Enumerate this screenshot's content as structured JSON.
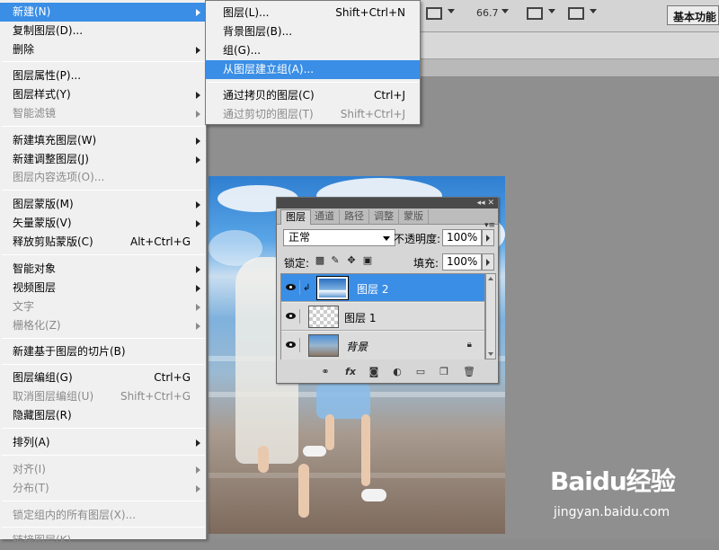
{
  "toolbar": {
    "zoom_value": "66.7",
    "workspace_label": "基本功能"
  },
  "menu": {
    "items": [
      {
        "label": "新建(N)",
        "shortcut": "",
        "submenu": true,
        "disabled": false,
        "highlighted": true
      },
      {
        "label": "复制图层(D)...",
        "shortcut": "",
        "submenu": false,
        "disabled": false
      },
      {
        "label": "删除",
        "shortcut": "",
        "submenu": true,
        "disabled": false
      },
      {
        "label": "图层属性(P)...",
        "shortcut": "",
        "submenu": false,
        "disabled": false
      },
      {
        "label": "图层样式(Y)",
        "shortcut": "",
        "submenu": true,
        "disabled": false
      },
      {
        "label": "智能滤镜",
        "shortcut": "",
        "submenu": true,
        "disabled": true
      },
      {
        "label": "新建填充图层(W)",
        "shortcut": "",
        "submenu": true,
        "disabled": false
      },
      {
        "label": "新建调整图层(J)",
        "shortcut": "",
        "submenu": true,
        "disabled": false
      },
      {
        "label": "图层内容选项(O)...",
        "shortcut": "",
        "submenu": false,
        "disabled": true
      },
      {
        "label": "图层蒙版(M)",
        "shortcut": "",
        "submenu": true,
        "disabled": false
      },
      {
        "label": "矢量蒙版(V)",
        "shortcut": "",
        "submenu": true,
        "disabled": false
      },
      {
        "label": "释放剪贴蒙版(C)",
        "shortcut": "Alt+Ctrl+G",
        "submenu": false,
        "disabled": false
      },
      {
        "label": "智能对象",
        "shortcut": "",
        "submenu": true,
        "disabled": false
      },
      {
        "label": "视频图层",
        "shortcut": "",
        "submenu": true,
        "disabled": false
      },
      {
        "label": "文字",
        "shortcut": "",
        "submenu": true,
        "disabled": true
      },
      {
        "label": "栅格化(Z)",
        "shortcut": "",
        "submenu": true,
        "disabled": true
      },
      {
        "label": "新建基于图层的切片(B)",
        "shortcut": "",
        "submenu": false,
        "disabled": false
      },
      {
        "label": "图层编组(G)",
        "shortcut": "Ctrl+G",
        "submenu": false,
        "disabled": false
      },
      {
        "label": "取消图层编组(U)",
        "shortcut": "Shift+Ctrl+G",
        "submenu": false,
        "disabled": true
      },
      {
        "label": "隐藏图层(R)",
        "shortcut": "",
        "submenu": false,
        "disabled": false
      },
      {
        "label": "排列(A)",
        "shortcut": "",
        "submenu": true,
        "disabled": false
      },
      {
        "label": "对齐(I)",
        "shortcut": "",
        "submenu": true,
        "disabled": true
      },
      {
        "label": "分布(T)",
        "shortcut": "",
        "submenu": true,
        "disabled": true
      },
      {
        "label": "锁定组内的所有图层(X)...",
        "shortcut": "",
        "submenu": false,
        "disabled": true
      },
      {
        "label": "链接图层(K)",
        "shortcut": "",
        "submenu": false,
        "disabled": true
      }
    ]
  },
  "submenu": {
    "items": [
      {
        "label": "图层(L)...",
        "shortcut": "Shift+Ctrl+N",
        "disabled": false,
        "highlighted": false
      },
      {
        "label": "背景图层(B)...",
        "shortcut": "",
        "disabled": false,
        "highlighted": false
      },
      {
        "label": "组(G)...",
        "shortcut": "",
        "disabled": false,
        "highlighted": false
      },
      {
        "label": "从图层建立组(A)...",
        "shortcut": "",
        "disabled": false,
        "highlighted": true
      },
      {
        "label": "通过拷贝的图层(C)",
        "shortcut": "Ctrl+J",
        "disabled": false,
        "highlighted": false
      },
      {
        "label": "通过剪切的图层(T)",
        "shortcut": "Shift+Ctrl+J",
        "disabled": true,
        "highlighted": false
      }
    ]
  },
  "layers_panel": {
    "tabs": [
      "图层",
      "通道",
      "路径",
      "调整",
      "蒙版"
    ],
    "active_tab": "图层",
    "blend_mode": "正常",
    "opacity_label": "不透明度:",
    "opacity_value": "100%",
    "lock_label": "锁定:",
    "fill_label": "填充:",
    "fill_value": "100%",
    "layers": [
      {
        "name": "图层 2",
        "selected": true,
        "clipped": true
      },
      {
        "name": "图层 1",
        "selected": false,
        "clipped": false
      },
      {
        "name": "背景",
        "selected": false,
        "clipped": false,
        "locked": true
      }
    ]
  },
  "watermark": {
    "logo": "Baidu经验",
    "url": "jingyan.baidu.com"
  },
  "colors": {
    "highlight": "#3a8ee6",
    "menu_bg": "#f0f0f0"
  }
}
